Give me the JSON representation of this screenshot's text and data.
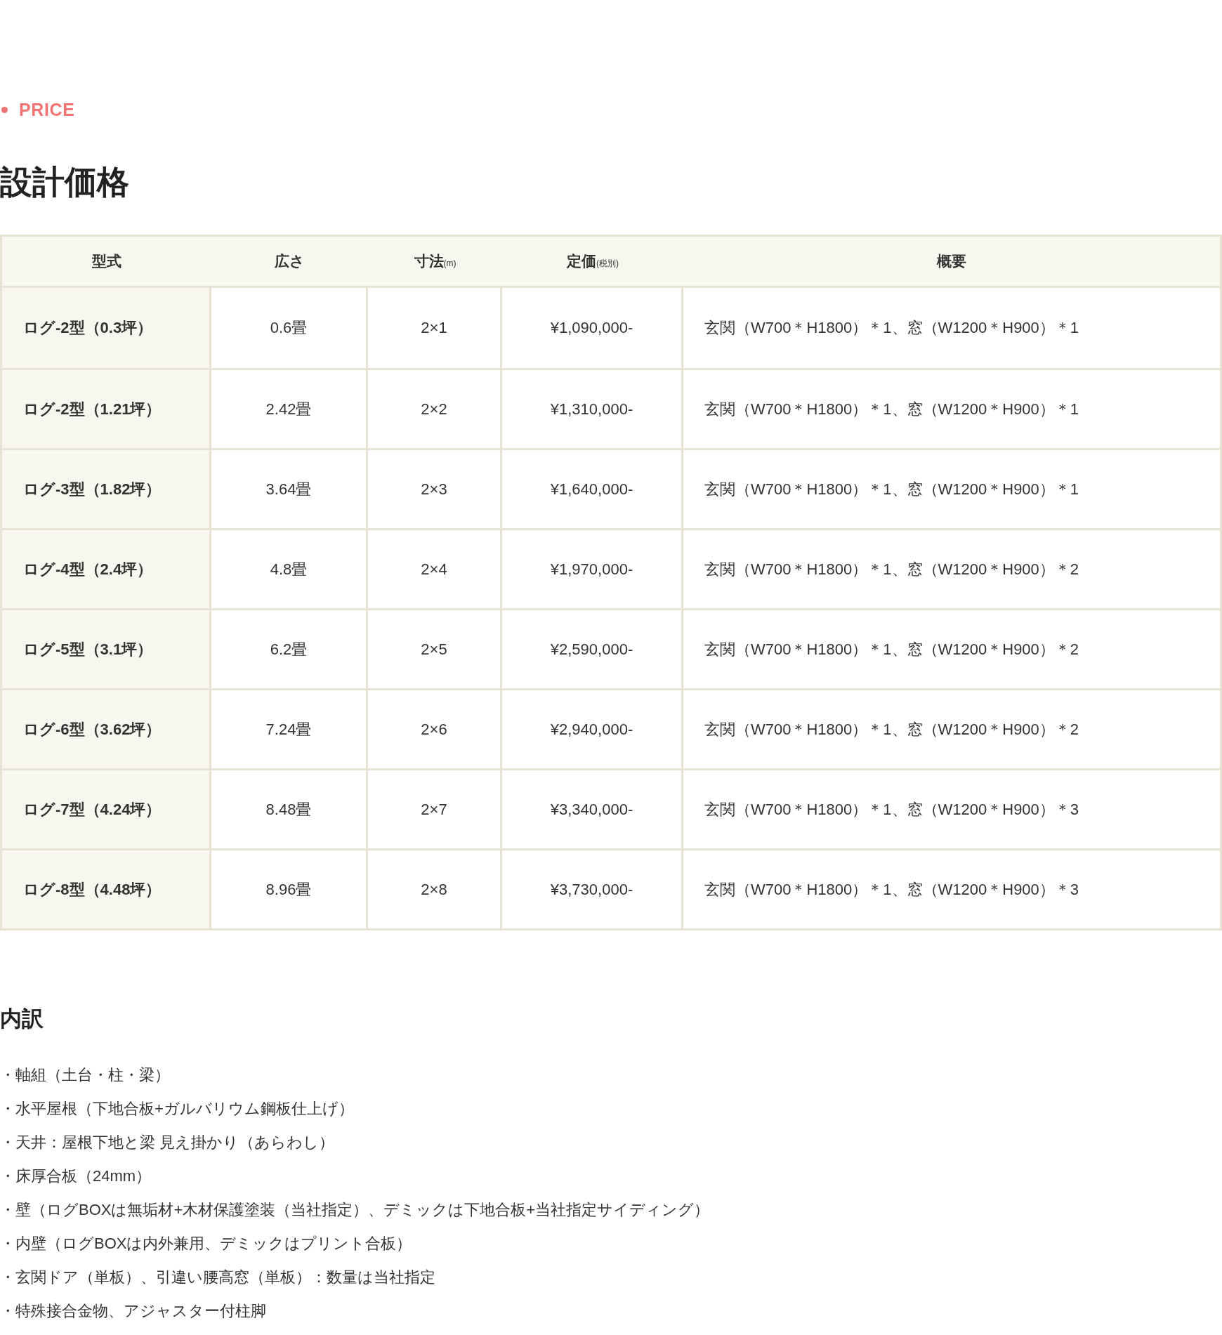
{
  "section_label": "PRICE",
  "title": "設計価格",
  "table": {
    "columns": [
      {
        "label": "型式"
      },
      {
        "label": "広さ"
      },
      {
        "label": "寸法",
        "note": "(m)"
      },
      {
        "label": "定価",
        "note": "(税別)"
      },
      {
        "label": "概要"
      }
    ],
    "rows": [
      {
        "model": "ログ-2型（0.3坪）",
        "area": "0.6畳",
        "size": "2×1",
        "price": "¥1,090,000-",
        "summary": "玄関（W700＊H1800）＊1、窓（W1200＊H900）＊1"
      },
      {
        "model": "ログ-2型（1.21坪）",
        "area": "2.42畳",
        "size": "2×2",
        "price": "¥1,310,000-",
        "summary": "玄関（W700＊H1800）＊1、窓（W1200＊H900）＊1"
      },
      {
        "model": "ログ-3型（1.82坪）",
        "area": "3.64畳",
        "size": "2×3",
        "price": "¥1,640,000-",
        "summary": "玄関（W700＊H1800）＊1、窓（W1200＊H900）＊1"
      },
      {
        "model": "ログ-4型（2.4坪）",
        "area": "4.8畳",
        "size": "2×4",
        "price": "¥1,970,000-",
        "summary": "玄関（W700＊H1800）＊1、窓（W1200＊H900）＊2"
      },
      {
        "model": "ログ-5型（3.1坪）",
        "area": "6.2畳",
        "size": "2×5",
        "price": "¥2,590,000-",
        "summary": "玄関（W700＊H1800）＊1、窓（W1200＊H900）＊2"
      },
      {
        "model": "ログ-6型（3.62坪）",
        "area": "7.24畳",
        "size": "2×6",
        "price": "¥2,940,000-",
        "summary": "玄関（W700＊H1800）＊1、窓（W1200＊H900）＊2"
      },
      {
        "model": "ログ-7型（4.24坪）",
        "area": "8.48畳",
        "size": "2×7",
        "price": "¥3,340,000-",
        "summary": "玄関（W700＊H1800）＊1、窓（W1200＊H900）＊3"
      },
      {
        "model": "ログ-8型（4.48坪）",
        "area": "8.96畳",
        "size": "2×8",
        "price": "¥3,730,000-",
        "summary": "玄関（W700＊H1800）＊1、窓（W1200＊H900）＊3"
      }
    ]
  },
  "breakdown": {
    "title": "内訳",
    "items": [
      "・軸組（土台・柱・梁）",
      "・水平屋根（下地合板+ガルバリウム鋼板仕上げ）",
      "・天井：屋根下地と梁 見え掛かり（あらわし）",
      "・床厚合板（24mm）",
      "・壁（ログBOXは無垢材+木材保護塗装（当社指定）、デミックは下地合板+当社指定サイディング）",
      "・内壁（ログBOXは内外兼用、デミックはプリント合板）",
      "・玄関ドア（単板）、引違い腰高窓（単板）：数量は当社指定",
      "・特殊接合金物、アジャスター付柱脚"
    ]
  }
}
